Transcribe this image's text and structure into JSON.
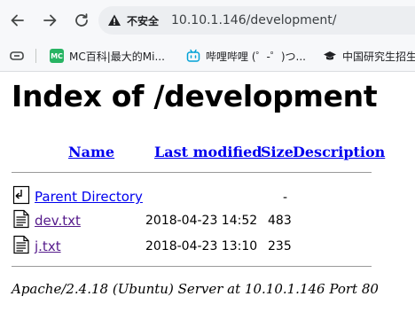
{
  "browser": {
    "security_label": "不安全",
    "url": "10.10.1.146/development/",
    "bookmarks": [
      {
        "label": "MC百科|最大的Mi...",
        "icon": "mc-icon",
        "icon_text": "MC"
      },
      {
        "label": "哔哩哔哩 (゜-゜)つ...",
        "icon": "bilibili-icon"
      },
      {
        "label": "中国研究生招生",
        "icon": "graduation-cap-icon"
      }
    ]
  },
  "page": {
    "title": "Index of /development",
    "columns": {
      "name": "Name",
      "last_modified": "Last modified",
      "size": "Size",
      "description": "Description"
    },
    "parent": {
      "name": "Parent Directory",
      "size": "-"
    },
    "files": [
      {
        "name": "dev.txt",
        "modified": "2018-04-23 14:52",
        "size": "483"
      },
      {
        "name": "j.txt",
        "modified": "2018-04-23 13:10",
        "size": "235"
      }
    ],
    "server_signature": "Apache/2.4.18 (Ubuntu) Server at 10.10.1.146 Port 80"
  }
}
